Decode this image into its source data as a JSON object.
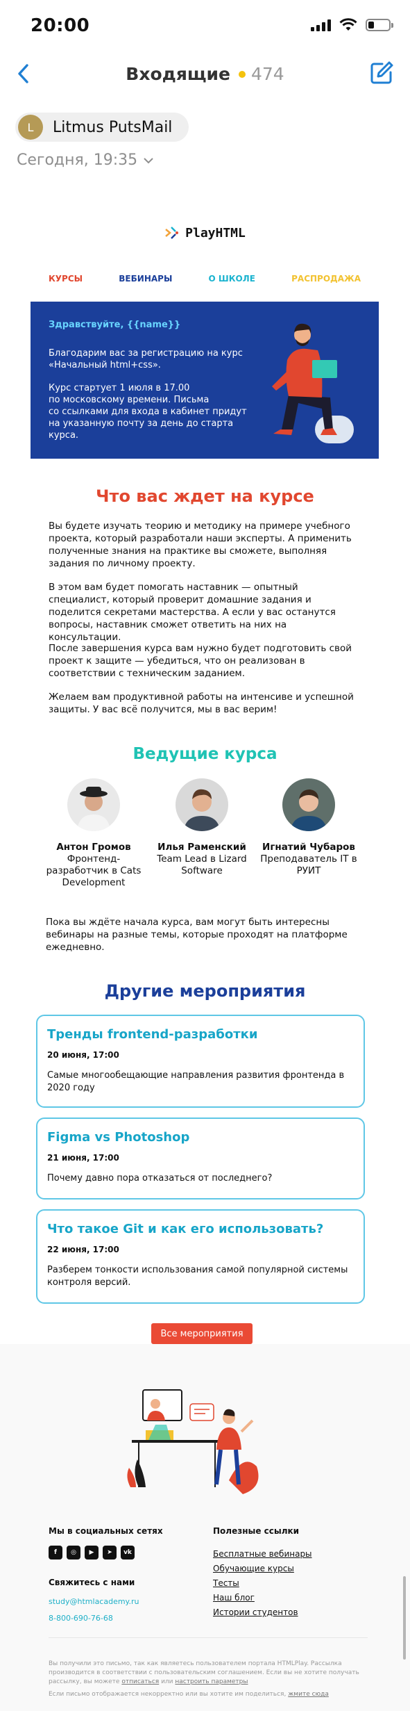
{
  "status": {
    "time": "20:00"
  },
  "nav": {
    "title": "Входящие",
    "unread": "474"
  },
  "sender": {
    "initial": "L",
    "name": "Litmus PutsMail",
    "date": "Сегодня, 19:35"
  },
  "logo": "PlayHTML",
  "menu": [
    {
      "label": "КУРСЫ",
      "color": "#e1472f"
    },
    {
      "label": "ВЕБИНАРЫ",
      "color": "#1b3f9a"
    },
    {
      "label": "О ШКОЛЕ",
      "color": "#1ab3cf"
    },
    {
      "label": "РАСПРОДАЖА",
      "color": "#f2c230"
    }
  ],
  "hero": {
    "greeting": "Здравствуйте, {{name}}",
    "text1": "Благодарим вас за регистрацию на курс\n«Начальный html+css».",
    "text2": "Курс стартует 1 июля в 17.00\nпо московскому времени. Письма\nсо ссылками для входа в кабинет придут\nна указанную почту за день до старта\nкурса."
  },
  "about": {
    "title": "Что вас ждет на курсе",
    "paragraphs": [
      "Вы будете изучать теорию и методику на примере учебного проекта, который разработали наши эксперты. А применить полученные знания на практике вы сможете, выполняя задания по личному проекту.",
      "В этом вам будет помогать наставник — опытный специалист, который проверит домашние задания и поделится секретами мастерства. А если у вас останутся вопросы, наставник сможет ответить на них на консультации.",
      "После завершения курса вам нужно будет подготовить свой проект к защите — убедиться, что он реализован в соответствии с техническим заданием.",
      "Желаем вам продуктивной работы на интенсиве и успешной защиты. У вас всё получится, мы в вас верим!"
    ]
  },
  "teachers": {
    "title": "Ведущие курса",
    "items": [
      {
        "name": "Антон Громов",
        "role": "Фронтенд-разработчик в Cats Development"
      },
      {
        "name": "Илья Раменский",
        "role": "Team Lead в Lizard Software"
      },
      {
        "name": "Игнатий Чубаров",
        "role": "Преподаватель IT в РУИТ"
      }
    ]
  },
  "webinars_note": "Пока вы ждёте начала курса, вам могут быть интересны вебинары на разные темы, которые проходят на платформе ежедневно.",
  "events": {
    "title": "Другие мероприятия",
    "items": [
      {
        "title": "Тренды frontend-разработки",
        "date": "20 июня, 17:00",
        "desc": "Самые многообещающие направления развития фронтенда в 2020 году"
      },
      {
        "title": "Figma vs Photoshop",
        "date": "21 июня, 17:00",
        "desc": "Почему давно пора отказаться от последнего?"
      },
      {
        "title": "Что такое Git и как его использовать?",
        "date": "22 июня, 17:00",
        "desc": "Разберем тонкости использования самой популярной системы контроля версий."
      }
    ],
    "button": "Все мероприятия"
  },
  "footer": {
    "social_title": "Мы в социальных сетях",
    "social_icons": [
      "facebook-icon",
      "instagram-icon",
      "youtube-icon",
      "telegram-icon",
      "vk-icon"
    ],
    "contact_title": "Свяжитесь с нами",
    "email": "study@htmlacademy.ru",
    "phone": "8-800-690-76-68",
    "links_title": "Полезные ссылки",
    "links": [
      "Бесплатные вебинары",
      "Обучающие курсы",
      "Тесты",
      "Наш блог",
      "Истории студентов"
    ],
    "note1_a": "Вы получили это письмо, так как являетесь пользователем портала HTMLPlay. Рассылка производится в соответствии с пользовательским соглашением. Если вы не хотите получать рассылку, вы можете",
    "note1_unsub": "отписаться",
    "note1_or": "или",
    "note1_settings": "настроить параметры",
    "note2_a": "Если письмо отображается некорректно или вы хотите им поделиться,",
    "note2_link": "жмите сюда"
  }
}
